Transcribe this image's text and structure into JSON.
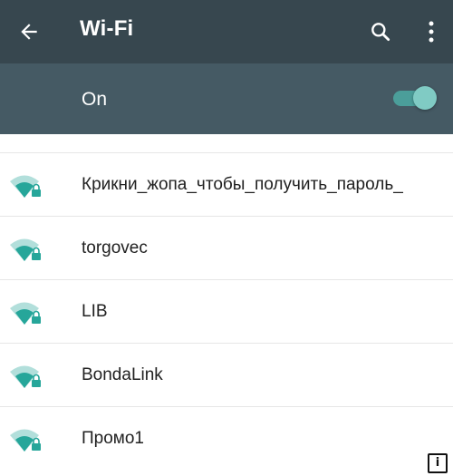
{
  "appbar": {
    "title": "Wi-Fi",
    "back_icon": "arrow-back-icon",
    "search_icon": "search-icon",
    "more_icon": "more-vert-icon",
    "background": "#37474f"
  },
  "master_switch": {
    "label": "On",
    "state": "on",
    "background": "#455a64",
    "accent": "#80cbc4"
  },
  "networks": [
    {
      "ssid": "Крикни_жопа_чтобы_получить_пароль_",
      "secured": true,
      "icon": "wifi-lock-icon"
    },
    {
      "ssid": "torgovec",
      "secured": true,
      "icon": "wifi-lock-icon"
    },
    {
      "ssid": "LIB",
      "secured": true,
      "icon": "wifi-lock-icon"
    },
    {
      "ssid": "BondaLink",
      "secured": true,
      "icon": "wifi-lock-icon"
    },
    {
      "ssid": "Промо1",
      "secured": true,
      "icon": "wifi-lock-icon"
    }
  ],
  "icon_color": "#26a69a"
}
